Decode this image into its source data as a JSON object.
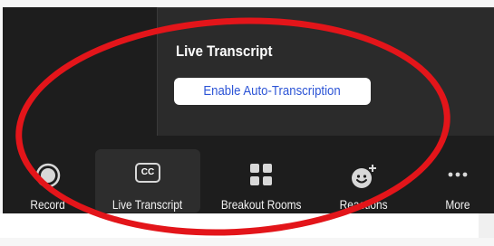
{
  "popup": {
    "title": "Live Transcript",
    "button_label": "Enable Auto-Transcription"
  },
  "toolbar": {
    "items": [
      {
        "label": "Record",
        "icon": "record-icon",
        "active": false
      },
      {
        "label": "Live Transcript",
        "icon": "cc-icon",
        "active": true
      },
      {
        "label": "Breakout Rooms",
        "icon": "breakout-rooms-icon",
        "active": false
      },
      {
        "label": "Reactions",
        "icon": "reactions-icon",
        "active": false
      },
      {
        "label": "More",
        "icon": "more-icon",
        "active": false
      }
    ],
    "cc_glyph": "CC"
  },
  "colors": {
    "toolbar_bg": "#1d1d1d",
    "popup_bg": "#2b2b2b",
    "button_text": "#2d55d6",
    "annotation": "#e3151a"
  }
}
